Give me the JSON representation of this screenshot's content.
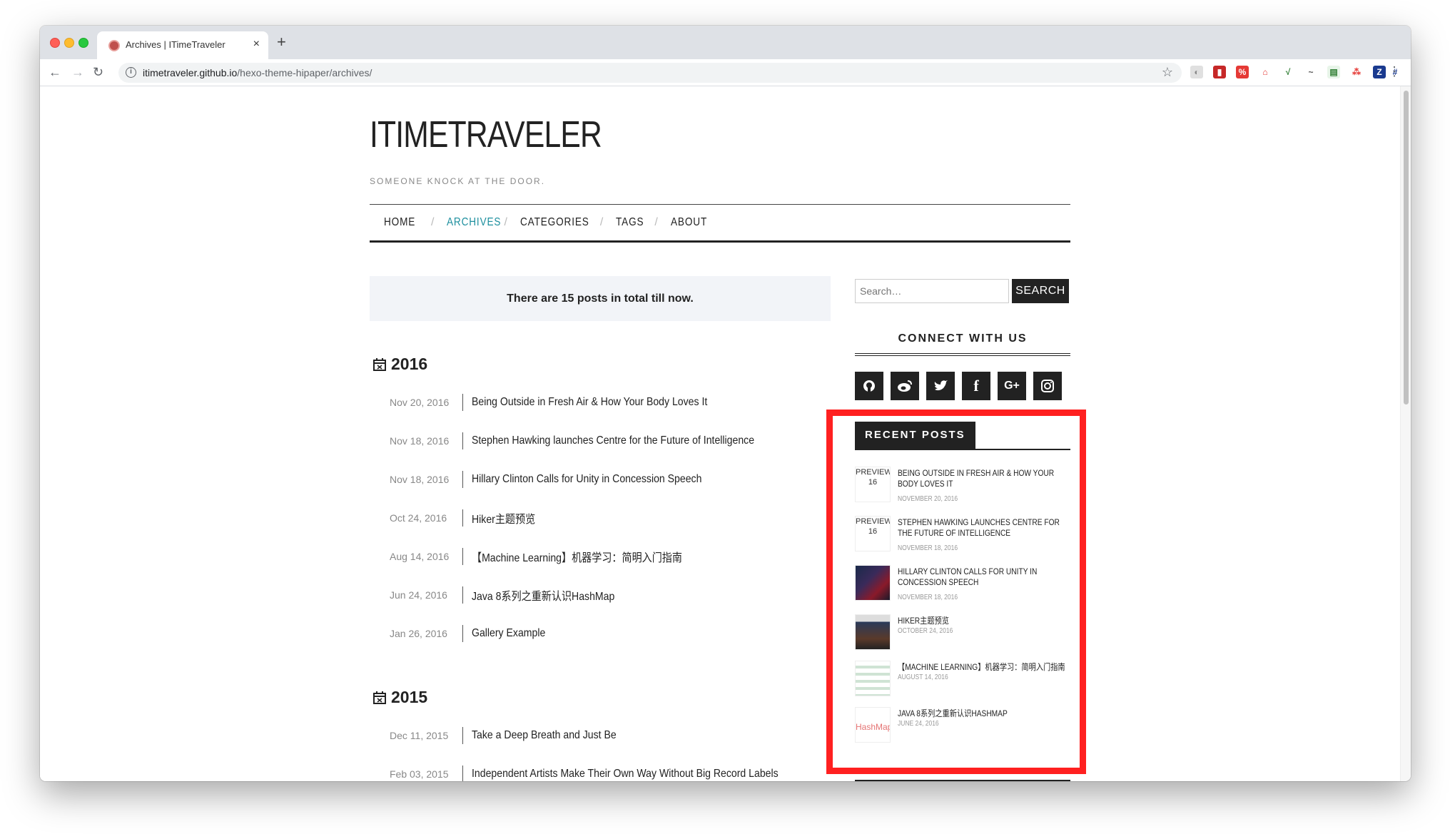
{
  "browser": {
    "tab_title": "Archives | ITimeTraveler",
    "tab_close": "×",
    "new_tab": "+",
    "url_domain": "itimetraveler.github.io",
    "url_path": "/hexo-theme-hipaper/archives/"
  },
  "site": {
    "title": "ITIMETRAVELER",
    "subtitle": "SOMEONE KNOCK AT THE DOOR.",
    "nav": [
      "HOME",
      "ARCHIVES",
      "CATEGORIES",
      "TAGS",
      "ABOUT"
    ],
    "nav_active": "ARCHIVES",
    "accent_color": "#1d8f9e"
  },
  "archive": {
    "total_text": "There are 15 posts in total till now.",
    "years": [
      {
        "year": "2016",
        "posts": [
          {
            "date": "Nov 20, 2016",
            "title": "Being Outside in Fresh Air & How Your Body Loves It"
          },
          {
            "date": "Nov 18, 2016",
            "title": "Stephen Hawking launches Centre for the Future of Intelligence"
          },
          {
            "date": "Nov 18, 2016",
            "title": "Hillary Clinton Calls for Unity in Concession Speech"
          },
          {
            "date": "Oct 24, 2016",
            "title": "Hiker主题预览"
          },
          {
            "date": "Aug 14, 2016",
            "title": "【Machine Learning】机器学习：简明入门指南"
          },
          {
            "date": "Jun 24, 2016",
            "title": "Java 8系列之重新认识HashMap"
          },
          {
            "date": "Jan 26, 2016",
            "title": "Gallery Example"
          }
        ]
      },
      {
        "year": "2015",
        "posts": [
          {
            "date": "Dec 11, 2015",
            "title": "Take a Deep Breath and Just Be"
          },
          {
            "date": "Feb 03, 2015",
            "title": "Independent Artists Make Their Own Way Without Big Record Labels"
          }
        ]
      }
    ]
  },
  "sidebar": {
    "search_placeholder": "Search…",
    "search_button": "SEARCH",
    "connect_title": "CONNECT WITH US",
    "social": [
      "github-icon",
      "weibo-icon",
      "twitter-icon",
      "facebook-icon",
      "google-plus-icon",
      "instagram-icon"
    ],
    "recent_title": "RECENT POSTS",
    "recent_posts": [
      {
        "title": "BEING OUTSIDE IN FRESH AIR & HOW YOUR BODY LOVES IT",
        "date": "NOVEMBER 20, 2016",
        "thumb_alt": "PREVIEW-16"
      },
      {
        "title": "STEPHEN HAWKING LAUNCHES CENTRE FOR THE FUTURE OF INTELLIGENCE",
        "date": "NOVEMBER 18, 2016",
        "thumb_alt": "PREVIEW-16"
      },
      {
        "title": "HILLARY CLINTON CALLS FOR UNITY IN CONCESSION SPEECH",
        "date": "NOVEMBER 18, 2016",
        "thumb_alt": ""
      },
      {
        "title": "HIKER主题预览",
        "date": "OCTOBER 24, 2016",
        "thumb_alt": ""
      },
      {
        "title": "【MACHINE LEARNING】机器学习：简明入门指南",
        "date": "AUGUST 14, 2016",
        "thumb_alt": ""
      },
      {
        "title": "JAVA 8系列之重新认识HASHMAP",
        "date": "JUNE 24, 2016",
        "thumb_alt": "HashMap"
      }
    ]
  },
  "annotation_color": "#ff2020"
}
